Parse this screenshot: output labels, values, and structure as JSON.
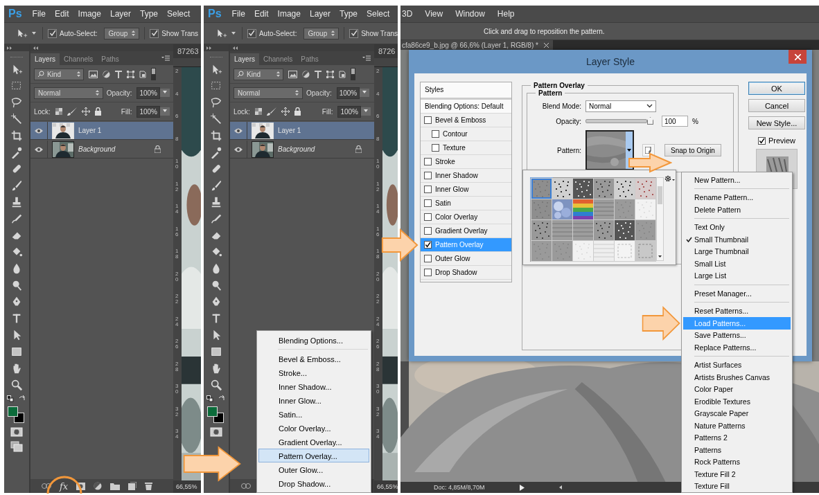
{
  "ps_windows": [
    {
      "logo": "Ps",
      "menu": [
        "File",
        "Edit",
        "Image",
        "Layer",
        "Type",
        "Select"
      ],
      "options": {
        "auto_select": {
          "label": "Auto-Select:",
          "checked": true
        },
        "group": "Group",
        "show_transform": {
          "label": "Show Trans",
          "checked": true
        }
      },
      "layers_panel": {
        "tabs": [
          {
            "label": "Layers",
            "selected": true
          },
          {
            "label": "Channels",
            "selected": false
          },
          {
            "label": "Paths",
            "selected": false
          }
        ],
        "filter": "Kind",
        "blend_mode": "Normal",
        "opacity_label": "Opacity:",
        "opacity": "100%",
        "lock_label": "Lock:",
        "fill_label": "Fill:",
        "fill": "100%",
        "layers": [
          {
            "name": "Layer 1",
            "kind": "layer",
            "selected": true,
            "visible": true,
            "locked": false
          },
          {
            "name": "Background",
            "kind": "background",
            "selected": false,
            "visible": true,
            "locked": true
          }
        ],
        "effects_button": {
          "label": "fx",
          "highlighted": true
        }
      },
      "document_tab": "87263",
      "ruler": [
        "2",
        "4",
        "6",
        "8",
        "10",
        "12",
        "14",
        "16",
        "18",
        "20",
        "22",
        "24",
        "26",
        "28",
        "30",
        "32",
        "34"
      ],
      "zoom": "66,55%"
    },
    {
      "logo": "Ps",
      "menu": [
        "File",
        "Edit",
        "Image",
        "Layer",
        "Type",
        "Select"
      ],
      "options": {
        "auto_select": {
          "label": "Auto-Select:",
          "checked": true
        },
        "group": "Group",
        "show_transform": {
          "label": "Show Trans",
          "checked": true
        }
      },
      "layers_panel": {
        "tabs": [
          {
            "label": "Layers",
            "selected": true
          },
          {
            "label": "Channels",
            "selected": false
          },
          {
            "label": "Paths",
            "selected": false
          }
        ],
        "filter": "Kind",
        "blend_mode": "Normal",
        "opacity_label": "Opacity:",
        "opacity": "100%",
        "lock_label": "Lock:",
        "fill_label": "Fill:",
        "fill": "100%",
        "layers": [
          {
            "name": "Layer 1",
            "kind": "layer",
            "selected": true,
            "visible": true,
            "locked": false
          },
          {
            "name": "Background",
            "kind": "background",
            "selected": false,
            "visible": true,
            "locked": true
          }
        ]
      },
      "document_tab": "8726",
      "ruler": [
        "2",
        "4",
        "6",
        "8",
        "10",
        "12",
        "14",
        "16",
        "18",
        "20",
        "22",
        "24",
        "26",
        "28",
        "30",
        "32",
        "34"
      ],
      "zoom": "66,55%",
      "context_menu": {
        "groups": [
          [
            {
              "label": "Blending Options...",
              "selected": false
            }
          ],
          [
            {
              "label": "Bevel & Emboss...",
              "selected": false
            },
            {
              "label": "Stroke...",
              "selected": false
            },
            {
              "label": "Inner Shadow...",
              "selected": false
            },
            {
              "label": "Inner Glow...",
              "selected": false
            },
            {
              "label": "Satin...",
              "selected": false
            },
            {
              "label": "Color Overlay...",
              "selected": false
            },
            {
              "label": "Gradient Overlay...",
              "selected": false
            },
            {
              "label": "Pattern Overlay...",
              "selected": true
            },
            {
              "label": "Outer Glow...",
              "selected": false
            },
            {
              "label": "Drop Shadow...",
              "selected": false
            }
          ]
        ]
      }
    }
  ],
  "editor": {
    "menu": [
      "3D",
      "View",
      "Window",
      "Help"
    ],
    "hint": "Click and drag to reposition the pattern.",
    "document_tab": "cfa86ce9_b.jpg @ 66,6% (Layer 1, RGB/8) *",
    "status": "Doc: 4,85M/8,70M",
    "layer_style": {
      "title": "Layer Style",
      "styles_header": "Styles",
      "blending_options": "Blending Options: Default",
      "effects": [
        {
          "label": "Bevel & Emboss",
          "checked": false,
          "selected": false,
          "children": [
            {
              "label": "Contour",
              "checked": false,
              "selected": false
            },
            {
              "label": "Texture",
              "checked": false,
              "selected": false
            }
          ]
        },
        {
          "label": "Stroke",
          "checked": false,
          "selected": false
        },
        {
          "label": "Inner Shadow",
          "checked": false,
          "selected": false
        },
        {
          "label": "Inner Glow",
          "checked": false,
          "selected": false
        },
        {
          "label": "Satin",
          "checked": false,
          "selected": false
        },
        {
          "label": "Color Overlay",
          "checked": false,
          "selected": false
        },
        {
          "label": "Gradient Overlay",
          "checked": false,
          "selected": false
        },
        {
          "label": "Pattern Overlay",
          "checked": true,
          "selected": true
        },
        {
          "label": "Outer Glow",
          "checked": false,
          "selected": false
        },
        {
          "label": "Drop Shadow",
          "checked": false,
          "selected": false
        }
      ],
      "section_title": "Pattern Overlay",
      "group_title": "Pattern",
      "blend_mode_label": "Blend Mode:",
      "blend_mode": "Normal",
      "opacity_label": "Opacity:",
      "opacity": {
        "level": 1,
        "value": "100",
        "unit": "%"
      },
      "pattern_label": "Pattern:",
      "snap_button": "Snap to Origin",
      "buttons": [
        {
          "label": "OK",
          "kind": "default"
        },
        {
          "label": "Cancel",
          "kind": "normal"
        },
        {
          "label": "New Style...",
          "kind": "normal"
        }
      ],
      "preview": {
        "label": "Preview",
        "checked": true
      },
      "swatches": [
        {
          "kind": "stone",
          "selected": true
        },
        {
          "kind": "noise-light",
          "selected": false
        },
        {
          "kind": "noise-dark",
          "selected": false
        },
        {
          "kind": "noise-mid",
          "selected": false
        },
        {
          "kind": "noise-light",
          "selected": false
        },
        {
          "kind": "noise-red",
          "selected": false
        },
        {
          "kind": "stone",
          "selected": false
        },
        {
          "kind": "bubbles",
          "selected": false
        },
        {
          "kind": "rainbow",
          "selected": false
        },
        {
          "kind": "lines",
          "selected": false
        },
        {
          "kind": "gray",
          "selected": false
        },
        {
          "kind": "white",
          "selected": false
        },
        {
          "kind": "noise-mid",
          "selected": false
        },
        {
          "kind": "lines",
          "selected": false
        },
        {
          "kind": "lines",
          "selected": false
        },
        {
          "kind": "noise-mid",
          "selected": false
        },
        {
          "kind": "noise-dark",
          "selected": false
        },
        {
          "kind": "gray",
          "selected": false
        },
        {
          "kind": "gray",
          "selected": false
        },
        {
          "kind": "gray",
          "selected": false
        },
        {
          "kind": "white",
          "selected": false
        },
        {
          "kind": "stripes",
          "selected": false
        },
        {
          "kind": "dashed",
          "selected": false
        },
        {
          "kind": "dashed-gray",
          "selected": false
        }
      ]
    },
    "pattern_menu": {
      "groups": [
        [
          {
            "label": "New Pattern...",
            "selected": false,
            "checked": false
          }
        ],
        [
          {
            "label": "Rename Pattern...",
            "selected": false,
            "checked": false
          },
          {
            "label": "Delete Pattern",
            "selected": false,
            "checked": false
          }
        ],
        [
          {
            "label": "Text Only",
            "selected": false,
            "checked": false
          },
          {
            "label": "Small Thumbnail",
            "selected": false,
            "checked": true
          },
          {
            "label": "Large Thumbnail",
            "selected": false,
            "checked": false
          },
          {
            "label": "Small List",
            "selected": false,
            "checked": false
          },
          {
            "label": "Large List",
            "selected": false,
            "checked": false
          }
        ],
        [
          {
            "label": "Preset Manager...",
            "selected": false,
            "checked": false
          }
        ],
        [
          {
            "label": "Reset Patterns...",
            "selected": false,
            "checked": false
          },
          {
            "label": "Load Patterns...",
            "selected": true,
            "checked": false
          },
          {
            "label": "Save Patterns...",
            "selected": false,
            "checked": false
          },
          {
            "label": "Replace Patterns...",
            "selected": false,
            "checked": false
          }
        ],
        [
          {
            "label": "Artist Surfaces",
            "selected": false,
            "checked": false
          },
          {
            "label": "Artists Brushes Canvas",
            "selected": false,
            "checked": false
          },
          {
            "label": "Color Paper",
            "selected": false,
            "checked": false
          },
          {
            "label": "Erodible Textures",
            "selected": false,
            "checked": false
          },
          {
            "label": "Grayscale Paper",
            "selected": false,
            "checked": false
          },
          {
            "label": "Nature Patterns",
            "selected": false,
            "checked": false
          },
          {
            "label": "Patterns 2",
            "selected": false,
            "checked": false
          },
          {
            "label": "Patterns",
            "selected": false,
            "checked": false
          },
          {
            "label": "Rock Patterns",
            "selected": false,
            "checked": false
          },
          {
            "label": "Texture Fill 2",
            "selected": false,
            "checked": false
          },
          {
            "label": "Texture Fill",
            "selected": false,
            "checked": false
          }
        ]
      ]
    }
  }
}
